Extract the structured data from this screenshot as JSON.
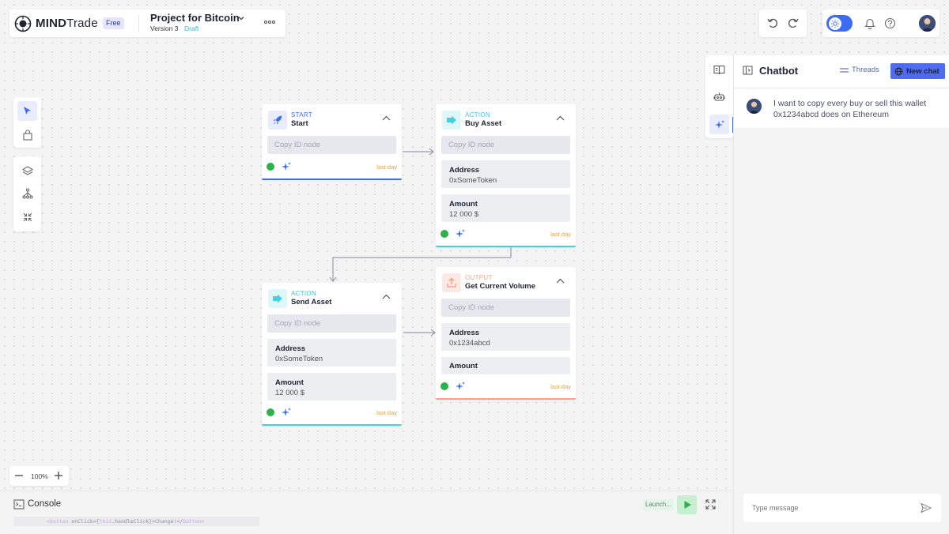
{
  "app": {
    "brand_bold": "MIND",
    "brand_light": "Trade",
    "plan": "Free"
  },
  "project": {
    "title": "Project for Bitcoin",
    "version": "Version 3",
    "status": "Draft"
  },
  "nodes": [
    {
      "type": "START",
      "title": "Start",
      "copy_placeholder": "Copy ID node",
      "time": "last day",
      "accent": "#3b6cf1"
    },
    {
      "type": "ACTION",
      "title": "Buy Asset",
      "copy_placeholder": "Copy ID node",
      "fields": [
        {
          "key": "Address",
          "value": "0xSomeToken"
        },
        {
          "key": "Amount",
          "value": "12 000 $"
        }
      ],
      "time": "last day",
      "accent": "#3fd3e0"
    },
    {
      "type": "ACTION",
      "title": "Send Asset",
      "copy_placeholder": "Copy ID node",
      "fields": [
        {
          "key": "Address",
          "value": "0xSomeToken"
        },
        {
          "key": "Amount",
          "value": "12 000 $"
        }
      ],
      "time": "last day",
      "accent": "#3fd3e0"
    },
    {
      "type": "OUTPUT",
      "title": "Get Current Volume",
      "copy_placeholder": "Copy ID node",
      "fields": [
        {
          "key": "Address",
          "value": "0x1234abcd"
        },
        {
          "key": "Amount",
          "value": ""
        }
      ],
      "time": "last day",
      "accent": "#f3a48f"
    }
  ],
  "zoom": {
    "level": "100%"
  },
  "console": {
    "title": "Console",
    "code_tag_open": "<button",
    "code_attr": " onClick={",
    "code_this": "this",
    "code_rest": ".handleClick}>Change!</",
    "code_tag_close": "button>",
    "launch_label": "Launch..."
  },
  "chat": {
    "title": "Chatbot",
    "threads_label": "Threads",
    "new_chat_label": "New chat",
    "message": "I want to copy every buy or sell this wallet 0x1234abcd does on Ethereum",
    "input_placeholder": "Type message"
  },
  "colors": {
    "accent": "#3b6cf1",
    "run_green": "#2bb34a",
    "time_orange": "#e6a23c"
  },
  "icons": [
    "logo-icon",
    "chevron-down-icon",
    "more-icon",
    "undo-icon",
    "redo-icon",
    "sun-icon",
    "bell-icon",
    "help-icon",
    "pointer-icon",
    "bag-icon",
    "layers-icon",
    "branch-icon",
    "collapse-icon",
    "minus-icon",
    "plus-icon",
    "terminal-icon",
    "play-icon",
    "expand-icon",
    "book-icon",
    "robot-icon",
    "sparkle-icon",
    "panel-icon",
    "threads-icon",
    "globe-icon",
    "send-icon",
    "rocket-icon",
    "arrow-right-icon",
    "upload-icon"
  ]
}
